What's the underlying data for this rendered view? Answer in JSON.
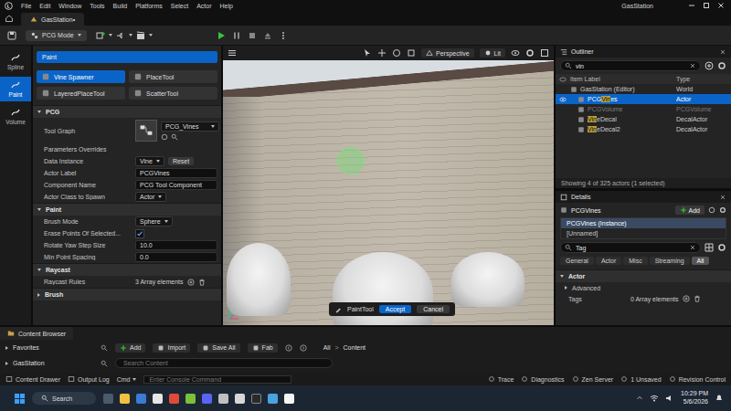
{
  "menu": [
    "File",
    "Edit",
    "Window",
    "Tools",
    "Build",
    "Platforms",
    "Select",
    "Actor",
    "Help"
  ],
  "window": {
    "title": "GasStation"
  },
  "level_tab": {
    "label": "GasStation•"
  },
  "toolbar": {
    "mode": "PCG Mode"
  },
  "modes": [
    {
      "label": "Spline",
      "selected": false
    },
    {
      "label": "Paint",
      "selected": true
    },
    {
      "label": "Volume",
      "selected": false
    }
  ],
  "tool_category": {
    "label": "Paint",
    "selected": true
  },
  "tools": [
    {
      "label": "Vine Spawner",
      "selected": true
    },
    {
      "label": "PlaceTool",
      "selected": false
    },
    {
      "label": "LayeredPlaceTool",
      "selected": false
    },
    {
      "label": "ScatterTool",
      "selected": false
    }
  ],
  "sections": [
    {
      "title": "PCG",
      "expanded": true,
      "rows": [
        {
          "kind": "graph",
          "label": "Tool Graph",
          "value": "PCG_Vines"
        },
        {
          "kind": "label",
          "label": "Parameters Overrides"
        },
        {
          "kind": "dropdown",
          "label": "Data Instance",
          "value": "Vine",
          "button": "Reset"
        },
        {
          "kind": "field",
          "label": "Actor Label",
          "value": "PCGVines"
        },
        {
          "kind": "field",
          "label": "Component Name",
          "value": "PCG Tool Component"
        },
        {
          "kind": "dropdown",
          "label": "Actor Class to Spawn",
          "value": "Actor"
        }
      ]
    },
    {
      "title": "Paint",
      "expanded": true,
      "rows": [
        {
          "kind": "dropdown",
          "label": "Brush Mode",
          "value": "Sphere"
        },
        {
          "kind": "check",
          "label": "Erase Points Of Selected...",
          "checked": true
        },
        {
          "kind": "field",
          "label": "Rotate Yaw Step Size",
          "value": "10.0"
        },
        {
          "kind": "field",
          "label": "Min Point Spacing",
          "value": "0.0"
        }
      ]
    },
    {
      "title": "Raycast",
      "expanded": true,
      "rows": [
        {
          "kind": "array",
          "label": "Raycast Rules",
          "value": "3 Array elements"
        }
      ]
    },
    {
      "title": "Brush",
      "expanded": false,
      "rows": []
    }
  ],
  "viewport": {
    "view": "Perspective",
    "lighting": "Lit",
    "tool_bar": {
      "tool": "PaintTool",
      "accept": "Accept",
      "cancel": "Cancel"
    }
  },
  "outliner": {
    "title": "Outliner",
    "search": "vin",
    "columns": [
      "Item Label",
      "Type"
    ],
    "rows": [
      {
        "label": "GasStation (Editor)",
        "type": "World",
        "depth": 0,
        "selected": false,
        "visible": false,
        "dimmed": false
      },
      {
        "label": "PCGVines",
        "type": "Actor",
        "depth": 1,
        "selected": true,
        "visible": true,
        "dimmed": false
      },
      {
        "label": "PCGVolume",
        "type": "PCGVolume",
        "depth": 1,
        "selected": false,
        "visible": false,
        "dimmed": true
      },
      {
        "label": "VineDecal",
        "type": "DecalActor",
        "depth": 1,
        "selected": false,
        "visible": false,
        "dimmed": false
      },
      {
        "label": "VineDecal2",
        "type": "DecalActor",
        "depth": 1,
        "selected": false,
        "visible": false,
        "dimmed": false
      }
    ],
    "status": "Showing 4 of 325 actors (1 selected)"
  },
  "details": {
    "title": "Details",
    "actor": "PCGVines",
    "add": "Add",
    "components": [
      {
        "label": "PCGVines (Instance)",
        "selected": true
      },
      {
        "label": "[Unnamed]",
        "selected": false
      }
    ],
    "search": "Tag",
    "tabs": [
      {
        "label": "General",
        "selected": false
      },
      {
        "label": "Actor",
        "selected": false
      },
      {
        "label": "Misc",
        "selected": false
      },
      {
        "label": "Streaming",
        "selected": false
      },
      {
        "label": "All",
        "selected": true
      }
    ],
    "section": "Actor",
    "subsection": "Advanced",
    "property": {
      "label": "Tags",
      "value": "0 Array elements"
    }
  },
  "content_browser": {
    "tab": "Content Browser",
    "favorites": "Favorites",
    "project": "GasStation",
    "buttons": [
      "Add",
      "Import",
      "Save All",
      "Fab"
    ],
    "path": [
      "All",
      "Content"
    ],
    "separator": ">",
    "search_placeholder": "Search Content"
  },
  "status_bar": {
    "left": [
      "Content Drawer",
      "Output Log"
    ],
    "cmd": "Cmd",
    "console_placeholder": "Enter Console Command",
    "right": [
      "Trace",
      "Diagnostics",
      "Zen Server",
      "1 Unsaved",
      "Revision Control"
    ]
  },
  "taskbar": {
    "search": "Search",
    "time": "10:29 PM",
    "date": "5/6/2026"
  }
}
